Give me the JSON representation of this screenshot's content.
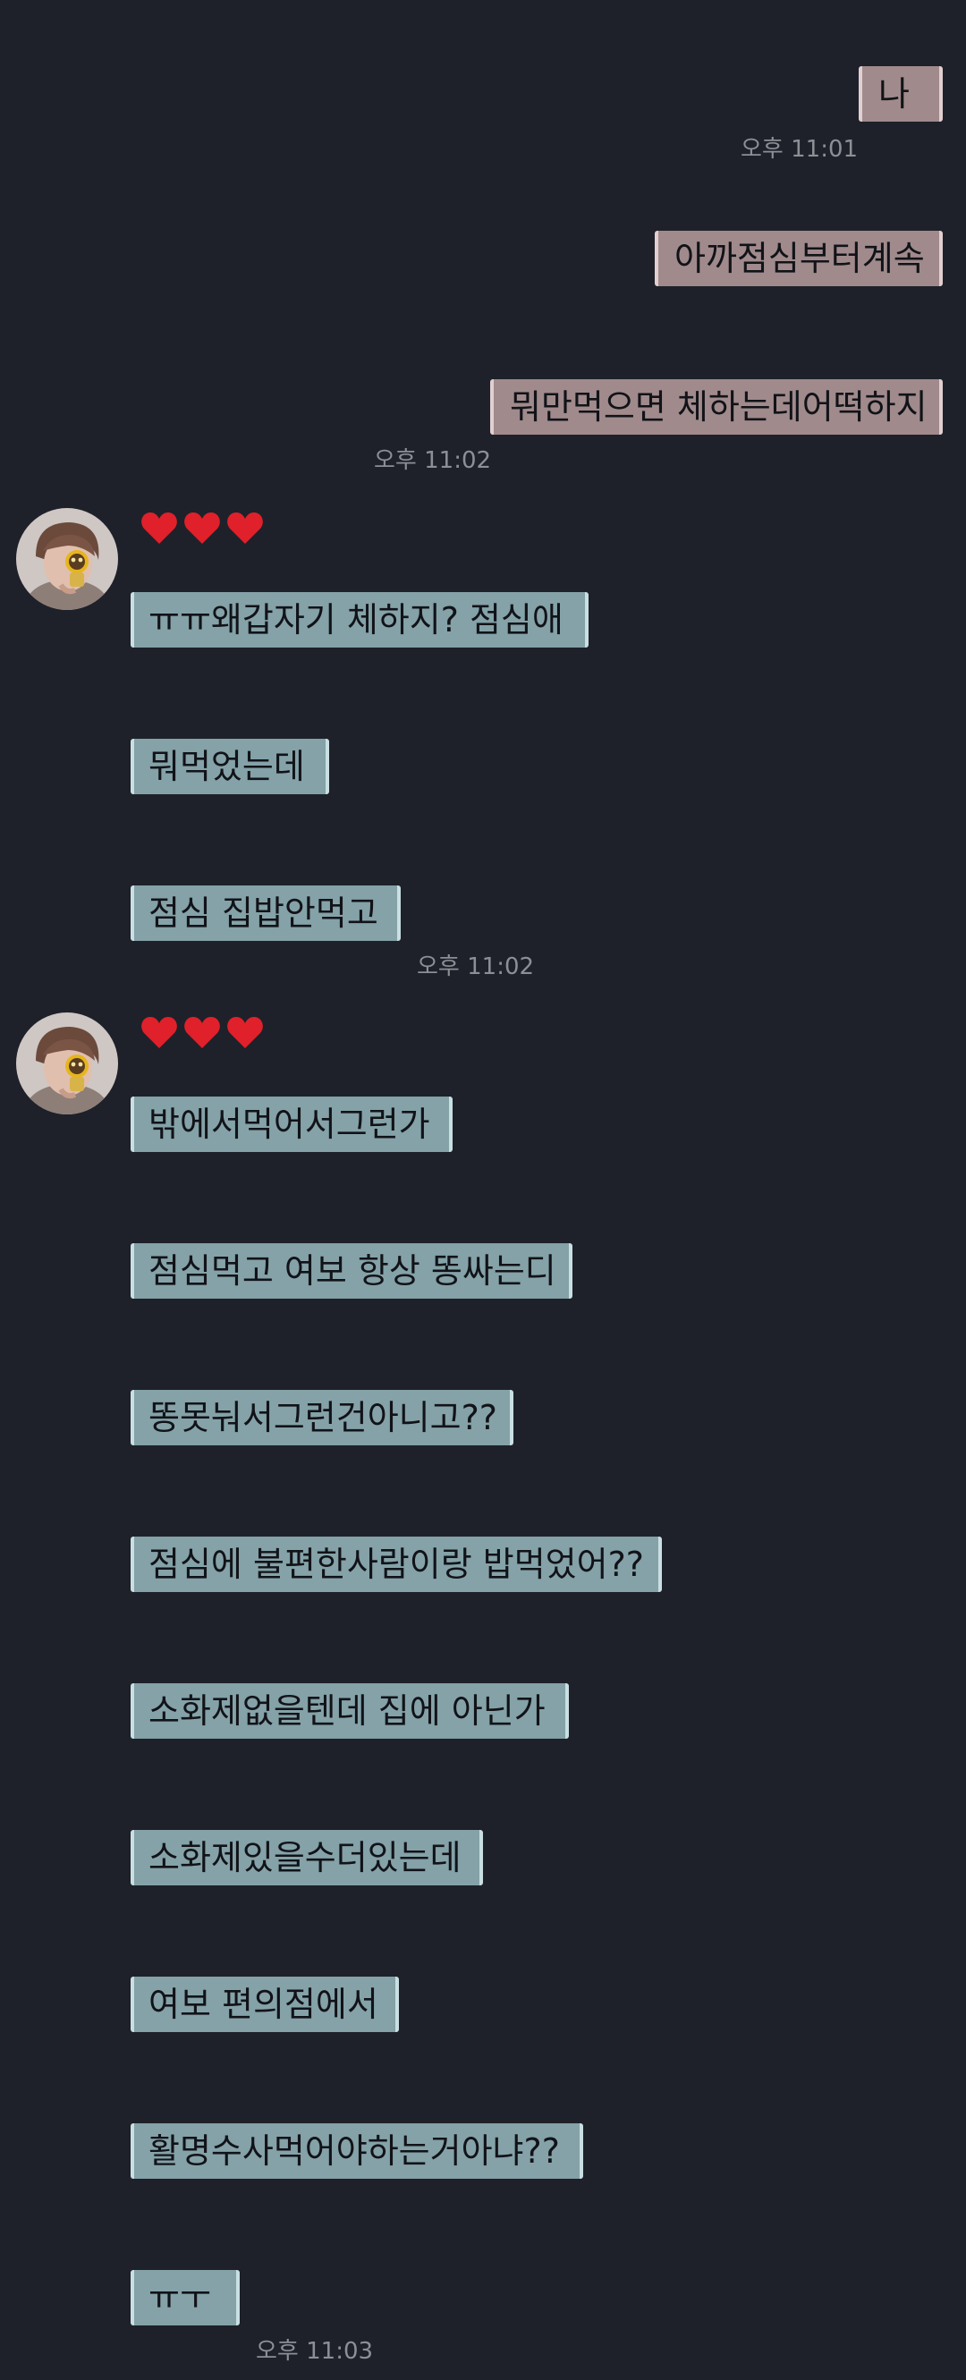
{
  "sent": [
    {
      "text": "나"
    },
    {
      "time": "오후 11:01"
    },
    {
      "text": "아까점심부터계속"
    },
    {
      "text": "뭐만먹으면 체하는데어떡하지"
    },
    {
      "time": "오후 11:02"
    }
  ],
  "groups": [
    {
      "reaction": [
        "heart",
        "heart",
        "heart"
      ],
      "messages": [
        {
          "text": "ㅠㅠ왜갑자기 체하지? 점심애"
        },
        {
          "text": "뭐먹었는데"
        },
        {
          "text": "점심 집밥안먹고"
        }
      ],
      "time": "오후 11:02"
    },
    {
      "reaction": [
        "heart",
        "heart",
        "heart"
      ],
      "messages": [
        {
          "text": "밖에서먹어서그런가"
        },
        {
          "text": "점심먹고 여보 항상 똥싸는디"
        },
        {
          "text": "똥못눠서그런건아니고??"
        },
        {
          "text": "점심에 불편한사람이랑 밥먹었어??"
        },
        {
          "text": "소화제없을텐데 집에 아닌가"
        },
        {
          "text": "소화제있을수더있는데"
        },
        {
          "text": "여보 편의점에서"
        },
        {
          "text": "활명수사먹어야하는거아냐??"
        },
        {
          "text": "ㅠㅜ"
        }
      ],
      "time": "오후 11:03"
    }
  ],
  "colors": {
    "background": "#1e2129",
    "sent_bubble": "#a08a8c",
    "received_bubble": "#84a2a8",
    "heart": "#e0202a",
    "timestamp": "#8c8f96"
  }
}
